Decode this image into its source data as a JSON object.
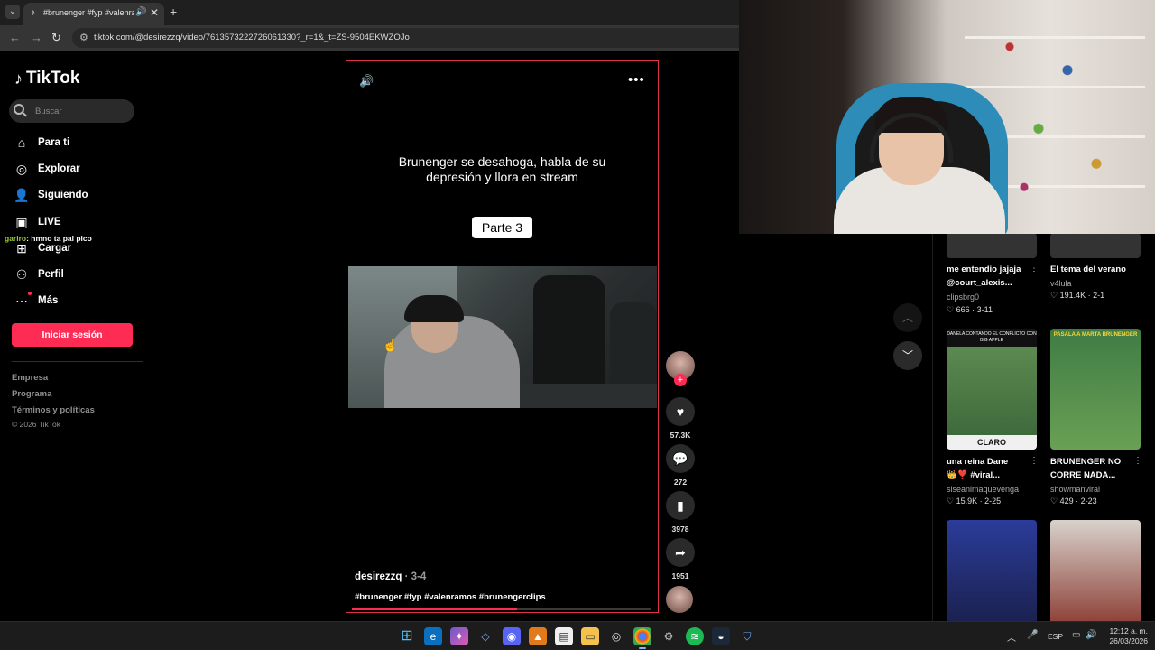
{
  "browser": {
    "tab_title": "#brunenger #fyp #valenram",
    "url": "tiktok.com/@desirezzq/video/7613573222726061330?_r=1&_t=ZS-9504EKWZOJo"
  },
  "sidebar": {
    "logo": "TikTok",
    "search_placeholder": "Buscar",
    "items": [
      {
        "label": "Para ti"
      },
      {
        "label": "Explorar"
      },
      {
        "label": "Siguiendo"
      },
      {
        "label": "LIVE"
      },
      {
        "label": "Cargar"
      },
      {
        "label": "Perfil"
      },
      {
        "label": "Más"
      }
    ],
    "login_label": "Iniciar sesión",
    "footer": [
      "Empresa",
      "Programa",
      "Términos y políticas"
    ],
    "copyright": "© 2026 TikTok"
  },
  "chat_overlay": {
    "user": "gariro",
    "message": ": hmno ta pal pico"
  },
  "video": {
    "title_text": "Brunenger se desahoga, habla de su depresión y llora en stream",
    "part_badge": "Parte 3",
    "author": "desirezzq",
    "date": "· 3-4",
    "hashtags": "#brunenger #fyp #valenramos #brunengerclips",
    "progress": 0.55,
    "accent": "#fe2c55"
  },
  "actions": {
    "likes": "57.3K",
    "comments": "272",
    "saves": "3978",
    "shares": "1951"
  },
  "recommended": [
    {
      "caption": "me entendio jajaja @court_alexis...",
      "author": "clipsbrg0",
      "likes": "666",
      "date": "3-11",
      "color": "#6b5a4a"
    },
    {
      "caption": "El tema del verano",
      "author": "v4lula",
      "likes": "191.4K",
      "date": "2-1",
      "color": "#c9a79a"
    },
    {
      "caption": "una reina Dane 👑❣️ #viral...",
      "author": "siseanimaquevenga",
      "likes": "15.9K",
      "date": "2-25",
      "color": "#4d7a4a",
      "banner": "DANELA CONTANDO EL CONFLICTO CON BIG APPLE",
      "footer": "CLARO"
    },
    {
      "caption": "BRUNENGER NO CORRE NADA...",
      "author": "showmanviral",
      "likes": "429",
      "date": "2-23",
      "color": "#4f8a48",
      "banner": "PASALA A MARTA BRUNENGER"
    },
    {
      "color": "#2a3a8a"
    },
    {
      "color": "#8a5a4a"
    }
  ],
  "taskbar": {
    "lang": "ESP",
    "time": "12:12 a. m.",
    "date": "26/03/2026"
  }
}
